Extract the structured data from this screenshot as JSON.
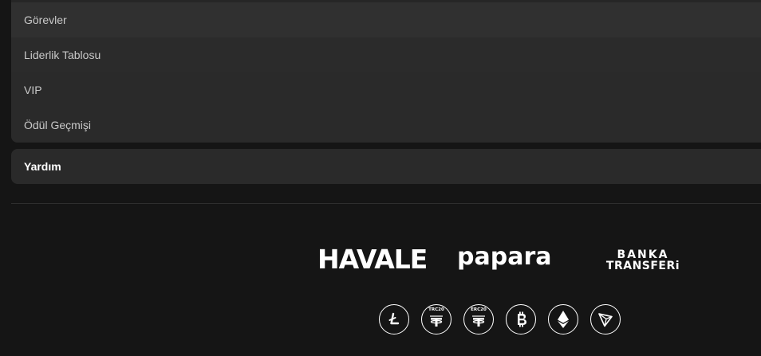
{
  "menu": {
    "items": [
      {
        "label": "Görevler"
      },
      {
        "label": "Liderlik Tablosu"
      },
      {
        "label": "VIP"
      },
      {
        "label": "Ödül Geçmişi"
      }
    ]
  },
  "help": {
    "label": "Yardım"
  },
  "payments": {
    "havale": "HAVALE",
    "papara": "papara",
    "banka_line1": "BANKA",
    "banka_line2": "TRANSFERi"
  },
  "crypto": {
    "icons": [
      "litecoin-icon",
      "tether-trc20-icon",
      "tether-erc20-icon",
      "bitcoin-icon",
      "ethereum-icon",
      "tron-icon"
    ],
    "trc20_label": "TRC20",
    "erc20_label": "ERC20"
  },
  "colors": {
    "background": "#151515",
    "panel": "#2a2a2a",
    "text": "#c9c9c9",
    "white": "#ffffff"
  }
}
